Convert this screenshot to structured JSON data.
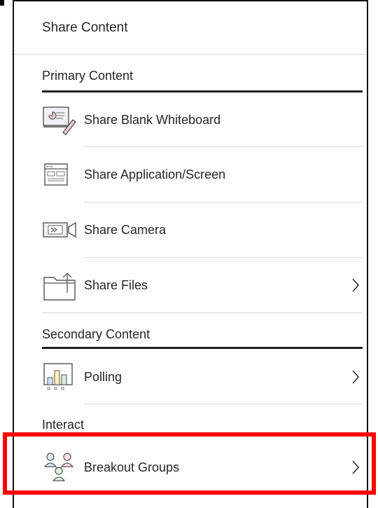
{
  "panel": {
    "title": "Share Content"
  },
  "sections": {
    "primary": "Primary Content",
    "secondary": "Secondary Content",
    "interact": "Interact"
  },
  "items": {
    "whiteboard": "Share Blank Whiteboard",
    "screen": "Share Application/Screen",
    "camera": "Share Camera",
    "files": "Share Files",
    "polling": "Polling",
    "breakout": "Breakout Groups"
  },
  "colors": {
    "highlight": "#ff0000",
    "text": "#262626",
    "divider": "#d8d8d8"
  }
}
